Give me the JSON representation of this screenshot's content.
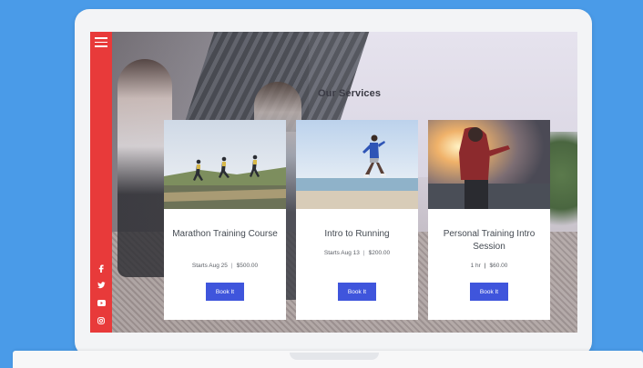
{
  "section": {
    "title": "Our Services"
  },
  "sidebar": {
    "menu_icon": "hamburger-icon",
    "social_icons": [
      "facebook-icon",
      "twitter-icon",
      "youtube-icon",
      "instagram-icon"
    ]
  },
  "cards": [
    {
      "title": "Marathon Training Course",
      "meta_left": "Starts Aug 25",
      "meta_right": "$500.00",
      "button_label": "Book It"
    },
    {
      "title": "Intro to Running",
      "meta_left": "Starts Aug 13",
      "meta_right": "$200.00",
      "button_label": "Book It"
    },
    {
      "title": "Personal Training Intro Session",
      "meta_left": "1 hr",
      "meta_right": "$60.00",
      "button_label": "Book It"
    }
  ],
  "colors": {
    "background": "#4a9be8",
    "sidebar": "#e83a3a",
    "button": "#3f55dc"
  }
}
